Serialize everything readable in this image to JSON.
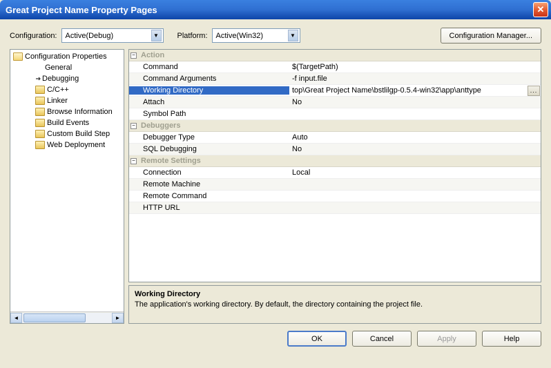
{
  "title": "Great Project Name Property Pages",
  "toprow": {
    "config_label": "Configuration:",
    "config_value": "Active(Debug)",
    "platform_label": "Platform:",
    "platform_value": "Active(Win32)",
    "config_mgr": "Configuration Manager..."
  },
  "tree": {
    "root": "Configuration Properties",
    "items": [
      {
        "label": "General",
        "icon": "none"
      },
      {
        "label": "Debugging",
        "icon": "arrow"
      },
      {
        "label": "C/C++",
        "icon": "folder"
      },
      {
        "label": "Linker",
        "icon": "folder"
      },
      {
        "label": "Browse Information",
        "icon": "folder"
      },
      {
        "label": "Build Events",
        "icon": "folder"
      },
      {
        "label": "Custom Build Step",
        "icon": "folder"
      },
      {
        "label": "Web Deployment",
        "icon": "folder"
      }
    ]
  },
  "groups": [
    {
      "title": "Action",
      "rows": [
        {
          "name": "Command",
          "value": "$(TargetPath)"
        },
        {
          "name": "Command Arguments",
          "value": "-f input.file"
        },
        {
          "name": "Working Directory",
          "value": "top\\Great Project Name\\bstlilgp-0.5.4-win32\\app\\anttype",
          "selected": true,
          "ellipsis": true
        },
        {
          "name": "Attach",
          "value": "No"
        },
        {
          "name": "Symbol Path",
          "value": ""
        }
      ]
    },
    {
      "title": "Debuggers",
      "rows": [
        {
          "name": "Debugger Type",
          "value": "Auto"
        },
        {
          "name": "SQL Debugging",
          "value": "No"
        }
      ]
    },
    {
      "title": "Remote Settings",
      "rows": [
        {
          "name": "Connection",
          "value": "Local"
        },
        {
          "name": "Remote Machine",
          "value": ""
        },
        {
          "name": "Remote Command",
          "value": ""
        },
        {
          "name": "HTTP URL",
          "value": ""
        }
      ]
    }
  ],
  "desc": {
    "title": "Working Directory",
    "text": "The application's working directory.  By default, the directory containing the project file."
  },
  "buttons": {
    "ok": "OK",
    "cancel": "Cancel",
    "apply": "Apply",
    "help": "Help"
  }
}
